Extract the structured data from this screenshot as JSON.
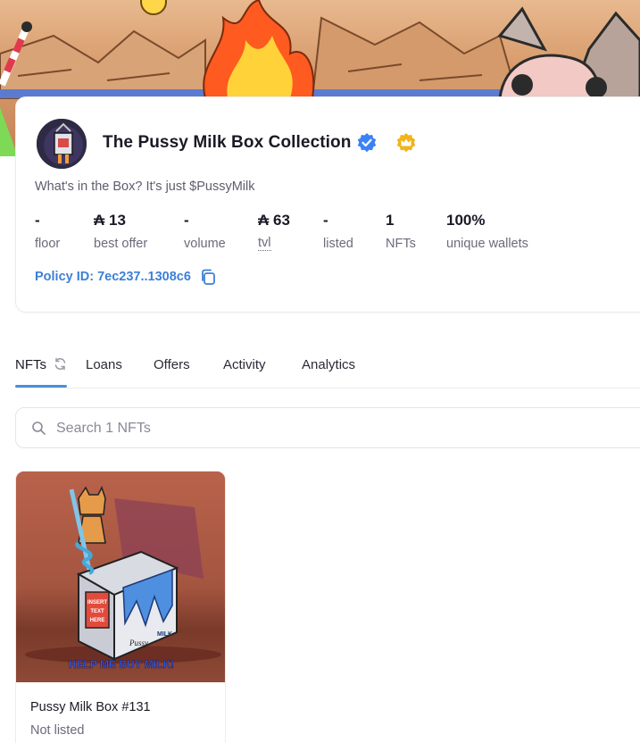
{
  "collection": {
    "title": "The Pussy Milk Box Collection",
    "description": "What's in the Box? It's just $PussyMilk",
    "policy_id": "Policy ID: 7ec237..1308c6",
    "badges": {
      "verified_icon": "verified-check-icon",
      "crown_icon": "crown-icon"
    },
    "stats": [
      {
        "value": "-",
        "label": "floor"
      },
      {
        "value": "₳ 13",
        "label": "best offer"
      },
      {
        "value": "-",
        "label": "volume"
      },
      {
        "value": "₳ 63",
        "label": "tvl"
      },
      {
        "value": "-",
        "label": "listed"
      },
      {
        "value": "1",
        "label": "NFTs"
      },
      {
        "value": "100%",
        "label": "unique wallets"
      }
    ]
  },
  "tabs": [
    {
      "label": "NFTs",
      "active": true
    },
    {
      "label": "Loans"
    },
    {
      "label": "Offers"
    },
    {
      "label": "Activity"
    },
    {
      "label": "Analytics"
    }
  ],
  "search": {
    "placeholder": "Search 1 NFTs",
    "value": ""
  },
  "nfts": [
    {
      "name": "Pussy Milk Box #131",
      "status": "Not listed",
      "image_text": "HELP ME BUY MILK!",
      "carton_label": "INSERT TEXT HERE",
      "carton_brand": "PUSSY MILK"
    }
  ],
  "colors": {
    "accent": "#3d7fd6",
    "tab_underline": "#4a8fd9",
    "crown": "#f2b416",
    "verified": "#3b82f6"
  }
}
